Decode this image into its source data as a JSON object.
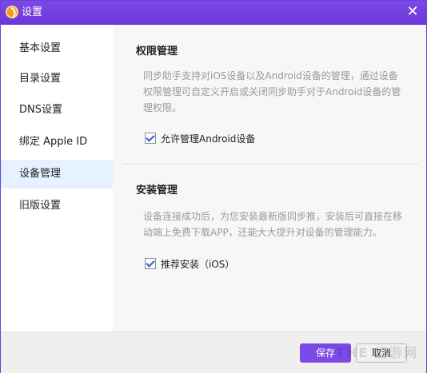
{
  "window": {
    "title": "设置",
    "close_glyph": "✕",
    "brand_color": "#6f3fd6"
  },
  "sidebar": {
    "items": [
      {
        "label": "基本设置"
      },
      {
        "label": "目录设置"
      },
      {
        "label": "DNS设置"
      },
      {
        "label": "绑定 Apple ID"
      },
      {
        "label": "设备管理",
        "active": true
      },
      {
        "label": "旧版设置"
      }
    ]
  },
  "permissions": {
    "title": "权限管理",
    "description": "同步助手支持对iOS设备以及Android设备的管理，通过设备权限管理可自定义开启或关闭同步助手对于Android设备的管理权限。",
    "checkbox_label": "允许管理Android设备",
    "checked": true
  },
  "install": {
    "title": "安装管理",
    "description": "设备连接成功后，为您安装最新版同步推，安装后可直接在移动端上免费下载APP，还能大大提升对设备的管理能力。",
    "checkbox_label": "推荐安装（iOS）",
    "checked": true
  },
  "footer": {
    "save_label": "保存",
    "cancel_label": "取消",
    "watermark": "THE 当游网"
  }
}
